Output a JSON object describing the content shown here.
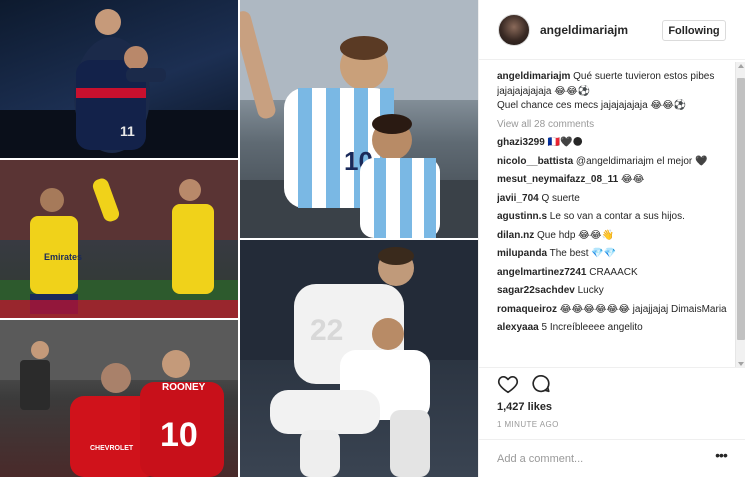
{
  "post": {
    "username": "angeldimariajm",
    "follow_label": "Following",
    "caption_user": "angeldimariajm",
    "caption_line1": "Qué suerte tuvieron estos pibes jajajajajajaja 😂😂⚽",
    "caption_line2": "Quel chance ces mecs jajajajajaja 😂😂⚽",
    "view_all": "View all 28 comments",
    "likes": "1,427 likes",
    "time": "1 MINUTE AGO",
    "add_comment_placeholder": "Add a comment...",
    "more_label": "•••"
  },
  "comments": [
    {
      "user": "ghazi3299",
      "text": "🇫🇷🖤🌑"
    },
    {
      "user": "nicolo__battista",
      "text": "@angeldimariajm el mejor 🖤"
    },
    {
      "user": "mesut_neymaifazz_08_11",
      "text": "😂😂"
    },
    {
      "user": "javii_704",
      "text": "Q suerte"
    },
    {
      "user": "agustinn.s",
      "text": "Le so van a contar a sus hijos."
    },
    {
      "user": "dilan.nz",
      "text": "Que hdp 😂😂👋"
    },
    {
      "user": "milupanda",
      "text": "The best 💎💎"
    },
    {
      "user": "angelmartinez7241",
      "text": "CRAAACK"
    },
    {
      "user": "sagar22sachdev",
      "text": "Lucky"
    },
    {
      "user": "romaqueiroz",
      "text": "😂😂😂😂😂😂 jajajjajaj DimaisMaria"
    },
    {
      "user": "alexyaaa",
      "text": "5 Increíbleeee angelito"
    }
  ],
  "icons": {
    "heart": "heart-icon",
    "comment": "comment-bubble-icon",
    "more": "more-options-icon"
  },
  "colors": {
    "text": "#262626",
    "muted": "#999999",
    "border": "#efefef"
  }
}
